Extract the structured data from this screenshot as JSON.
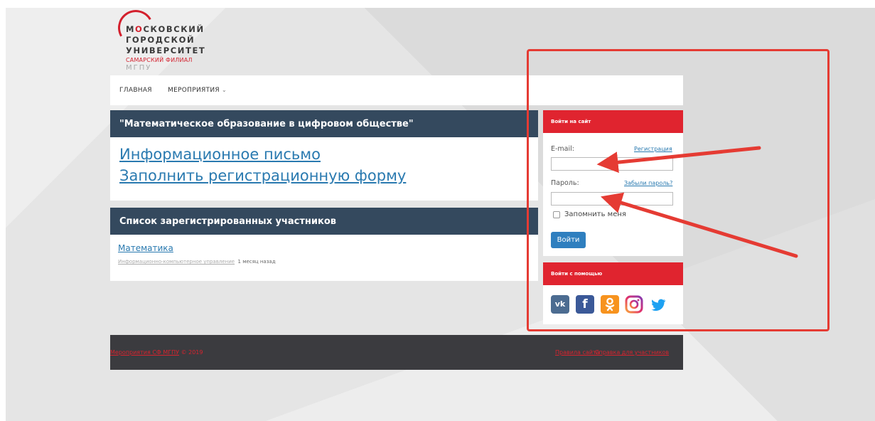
{
  "logo": {
    "line1_a": "М",
    "line1_b": "О",
    "line1_c": "СКОВСКИЙ",
    "line2": "ГОРОДСКОЙ",
    "line3": "УНИВЕРСИТЕТ",
    "sub": "САМАРСКИЙ ФИЛИАЛ",
    "abbr": "МГПУ"
  },
  "nav": {
    "home": "ГЛАВНАЯ",
    "events": "МЕРОПРИЯТИЯ"
  },
  "main": {
    "event_title": "\"Математическое образование в цифровом обществе\"",
    "info_letter_link": "Информационное письмо",
    "registration_form_link": "Заполнить регистрационную форму",
    "participants_title": "Список зарегистрированных участников",
    "subject_link": "Математика",
    "category_link": "Информационно-компьютерное управление",
    "time_ago": "1 месяц назад"
  },
  "login": {
    "header": "Войти на сайт",
    "email_label": "E-mail:",
    "register_link": "Регистрация",
    "email_value": "",
    "password_label": "Пароль:",
    "forgot_link": "Забыли пароль?",
    "password_value": "",
    "remember_label": "Запомнить меня",
    "remember_checked": false,
    "submit_label": "Войти"
  },
  "social": {
    "header": "Войти с помощью",
    "vk_glyph": "vk",
    "fb_glyph": "f",
    "icons": [
      "vk-icon",
      "facebook-icon",
      "odnoklassniki-icon",
      "instagram-icon",
      "twitter-icon"
    ]
  },
  "footer": {
    "events_link": "Мероприятия СФ МГПУ",
    "copyright": "© 2019",
    "rules_link": "Правила сайта",
    "help_link": "Справка для участников"
  },
  "colors": {
    "accent_red": "#e0242f",
    "panel_dark": "#34495e",
    "link_blue": "#2a7ab0",
    "footer_bg": "#3b3b3f",
    "annotation_red": "#e53b33"
  }
}
